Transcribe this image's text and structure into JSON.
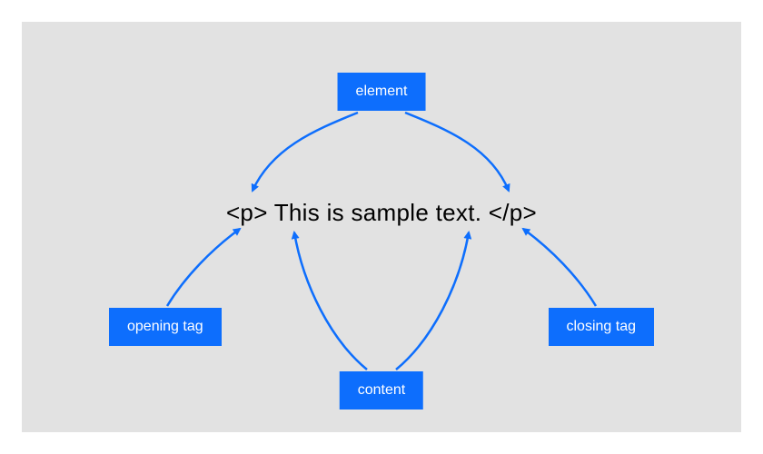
{
  "labels": {
    "element": "element",
    "opening_tag": "opening tag",
    "closing_tag": "closing tag",
    "content": "content"
  },
  "code": {
    "open_tag": "<p> ",
    "text_content": "This is sample text.",
    "close_tag": " </p>"
  },
  "colors": {
    "label_bg": "#0d6efd",
    "label_text": "#ffffff",
    "canvas_bg": "#e2e2e2",
    "arrow": "#0d6efd"
  }
}
